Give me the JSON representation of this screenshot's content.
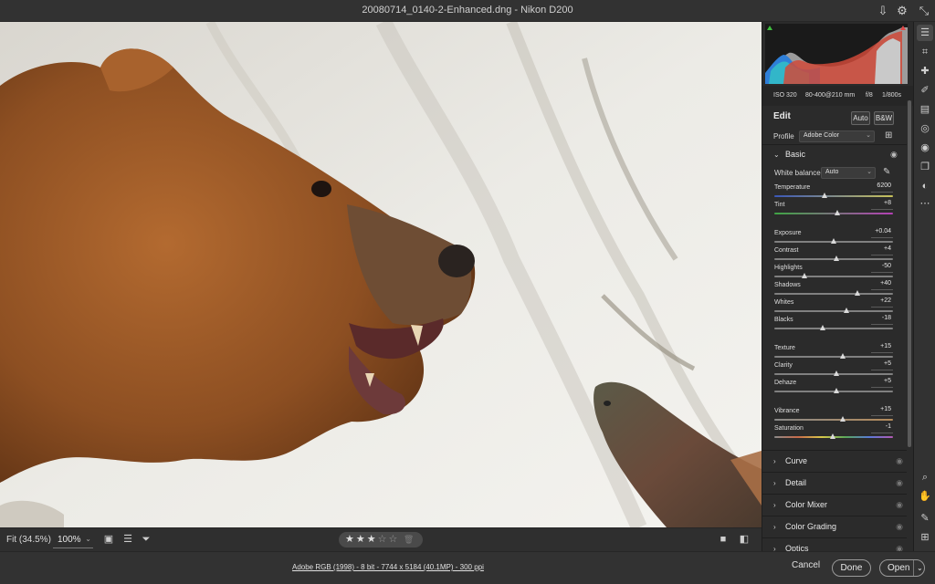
{
  "window": {
    "title": "20080714_0140-2-Enhanced.dng  -  Nikon D200"
  },
  "photo_bar": {
    "fit_label": "Fit (34.5%)",
    "zoom_value": "100%",
    "rating": 3,
    "rating_max": 5
  },
  "status_bar": {
    "file_info": "Adobe RGB (1998) - 8 bit - 7744 x 5184 (40.1MP) - 300 ppi",
    "cancel": "Cancel",
    "done": "Done",
    "open": "Open"
  },
  "exif": {
    "iso": "ISO 320",
    "lens": "80-400@210 mm",
    "aperture": "f/8",
    "shutter": "1/800s"
  },
  "edit": {
    "title": "Edit",
    "auto": "Auto",
    "bw": "B&W",
    "profile_label": "Profile",
    "profile_value": "Adobe Color"
  },
  "basic": {
    "title": "Basic",
    "wb_label": "White balance",
    "wb_value": "Auto",
    "sliders": [
      {
        "name": "Temperature",
        "value": "6200",
        "pos": 0.42
      },
      {
        "name": "Tint",
        "value": "+8",
        "pos": 0.53
      },
      {
        "name": "Exposure",
        "value": "+0.04",
        "pos": 0.5
      },
      {
        "name": "Contrast",
        "value": "+4",
        "pos": 0.52
      },
      {
        "name": "Highlights",
        "value": "-50",
        "pos": 0.25
      },
      {
        "name": "Shadows",
        "value": "+40",
        "pos": 0.7
      },
      {
        "name": "Whites",
        "value": "+22",
        "pos": 0.61
      },
      {
        "name": "Blacks",
        "value": "-18",
        "pos": 0.41
      },
      {
        "name": "Texture",
        "value": "+15",
        "pos": 0.575
      },
      {
        "name": "Clarity",
        "value": "+5",
        "pos": 0.525
      },
      {
        "name": "Dehaze",
        "value": "+5",
        "pos": 0.525
      },
      {
        "name": "Vibrance",
        "value": "+15",
        "pos": 0.575
      },
      {
        "name": "Saturation",
        "value": "-1",
        "pos": 0.495
      }
    ]
  },
  "sections": [
    "Curve",
    "Detail",
    "Color Mixer",
    "Color Grading",
    "Optics"
  ],
  "colors": {
    "panel_bg": "#2b2b2b",
    "canvas_bg": "#e3e1dc",
    "bear_fur": "#9a5a2a"
  },
  "icons": {
    "top_right": [
      "save-icon",
      "gear-icon",
      "collapse-icon"
    ],
    "tools": [
      "edit-sliders-icon",
      "crop-icon",
      "healing-icon",
      "brush-icon",
      "linear-gradient-icon",
      "radial-gradient-icon",
      "red-eye-icon",
      "snapshots-icon",
      "presets-icon",
      "more-icon",
      "zoom-icon",
      "hand-icon",
      "color-sampler-icon",
      "grid-icon"
    ]
  }
}
